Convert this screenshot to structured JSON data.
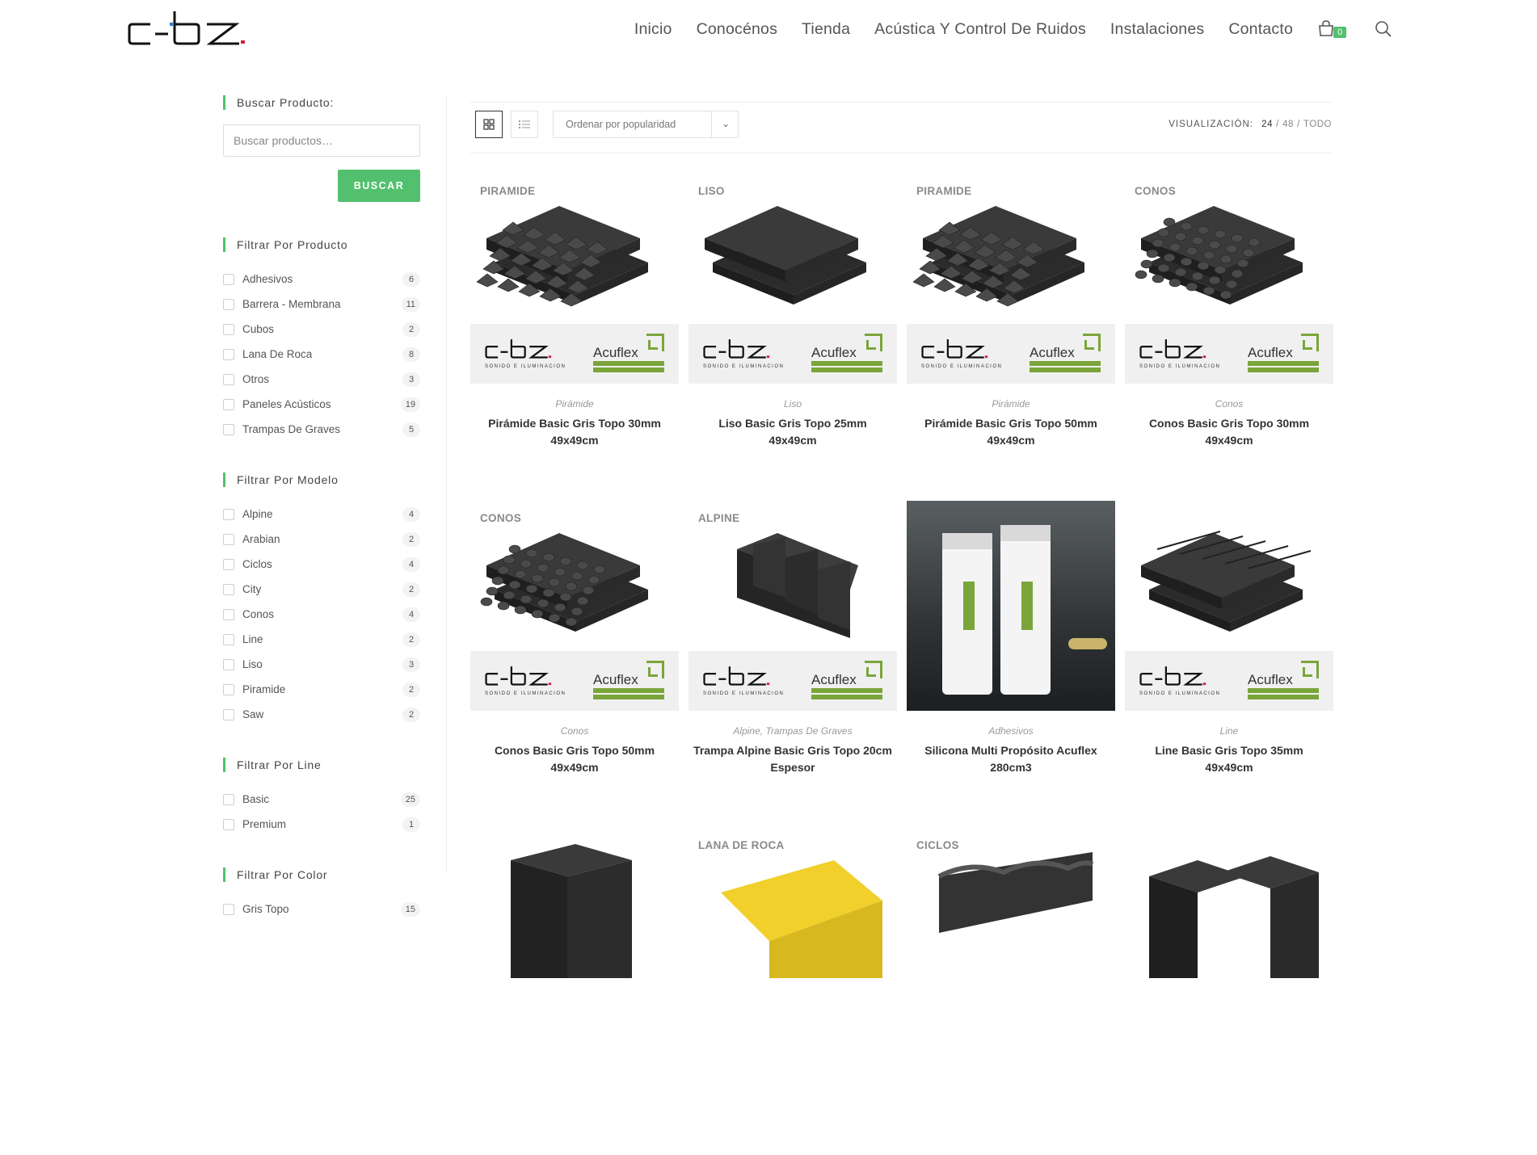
{
  "brand": {
    "name": "c-bz"
  },
  "nav": {
    "items": [
      "Inicio",
      "Conocénos",
      "Tienda",
      "Acústica Y Control De Ruidos",
      "Instalaciones",
      "Contacto"
    ],
    "cart_count": "0"
  },
  "sidebar": {
    "search_title": "Buscar Producto:",
    "search_placeholder": "Buscar productos…",
    "search_button": "BUSCAR",
    "producto": {
      "title": "Filtrar Por Producto",
      "items": [
        {
          "label": "Adhesivos",
          "count": "6"
        },
        {
          "label": "Barrera - Membrana",
          "count": "11"
        },
        {
          "label": "Cubos",
          "count": "2"
        },
        {
          "label": "Lana De Roca",
          "count": "8"
        },
        {
          "label": "Otros",
          "count": "3"
        },
        {
          "label": "Paneles Acústicos",
          "count": "19"
        },
        {
          "label": "Trampas De Graves",
          "count": "5"
        }
      ]
    },
    "modelo": {
      "title": "Filtrar Por Modelo",
      "items": [
        {
          "label": "Alpine",
          "count": "4"
        },
        {
          "label": "Arabian",
          "count": "2"
        },
        {
          "label": "Ciclos",
          "count": "4"
        },
        {
          "label": "City",
          "count": "2"
        },
        {
          "label": "Conos",
          "count": "4"
        },
        {
          "label": "Line",
          "count": "2"
        },
        {
          "label": "Liso",
          "count": "3"
        },
        {
          "label": "Piramide",
          "count": "2"
        },
        {
          "label": "Saw",
          "count": "2"
        }
      ]
    },
    "line": {
      "title": "Filtrar Por Line",
      "items": [
        {
          "label": "Basic",
          "count": "25"
        },
        {
          "label": "Premium",
          "count": "1"
        }
      ]
    },
    "color": {
      "title": "Filtrar Por Color",
      "items": [
        {
          "label": "Gris Topo",
          "count": "15"
        }
      ]
    }
  },
  "toolbar": {
    "sort_label": "Ordenar por popularidad",
    "view_label": "VISUALIZACIÓN:",
    "view_current": "24",
    "view_48": "48",
    "view_all": "TODO",
    "slash": "/"
  },
  "brandbar": {
    "cbz_sub": "SONIDO E ILUMINACION",
    "acuflex": "Acuflex",
    "acuflex_sub": "AISLANTES DE RUIDO"
  },
  "products": [
    {
      "tag": "PIRAMIDE",
      "category": "Pirámide",
      "title": "Pirámide Basic Gris Topo 30mm 49x49cm",
      "shape": "pyramid"
    },
    {
      "tag": "LISO",
      "category": "Liso",
      "title": "Liso Basic Gris Topo 25mm 49x49cm",
      "shape": "flat"
    },
    {
      "tag": "PIRAMIDE",
      "category": "Pirámide",
      "title": "Pirámide Basic Gris Topo 50mm 49x49cm",
      "shape": "pyramid"
    },
    {
      "tag": "CONOS",
      "category": "Conos",
      "title": "Conos Basic Gris Topo 30mm 49x49cm",
      "shape": "egg"
    },
    {
      "tag": "CONOS",
      "category": "Conos",
      "title": "Conos Basic Gris Topo 50mm 49x49cm",
      "shape": "egg"
    },
    {
      "tag": "ALPINE",
      "category": "Alpine, Trampas De Graves",
      "title": "Trampa Alpine Basic Gris Topo 20cm Espesor",
      "shape": "alpine"
    },
    {
      "tag": "",
      "category": "Adhesivos",
      "title": "Silicona Multi Propósito Acuflex 280cm3",
      "shape": "photo"
    },
    {
      "tag": "",
      "category": "Line",
      "title": "Line Basic Gris Topo 35mm 49x49cm",
      "shape": "line"
    },
    {
      "tag": "",
      "category": "",
      "title": "",
      "shape": "cube"
    },
    {
      "tag": "LANA DE ROCA",
      "category": "",
      "title": "",
      "shape": "rock"
    },
    {
      "tag": "CICLOS",
      "category": "",
      "title": "",
      "shape": "ciclos"
    },
    {
      "tag": "",
      "category": "",
      "title": "",
      "shape": "blocks"
    }
  ]
}
